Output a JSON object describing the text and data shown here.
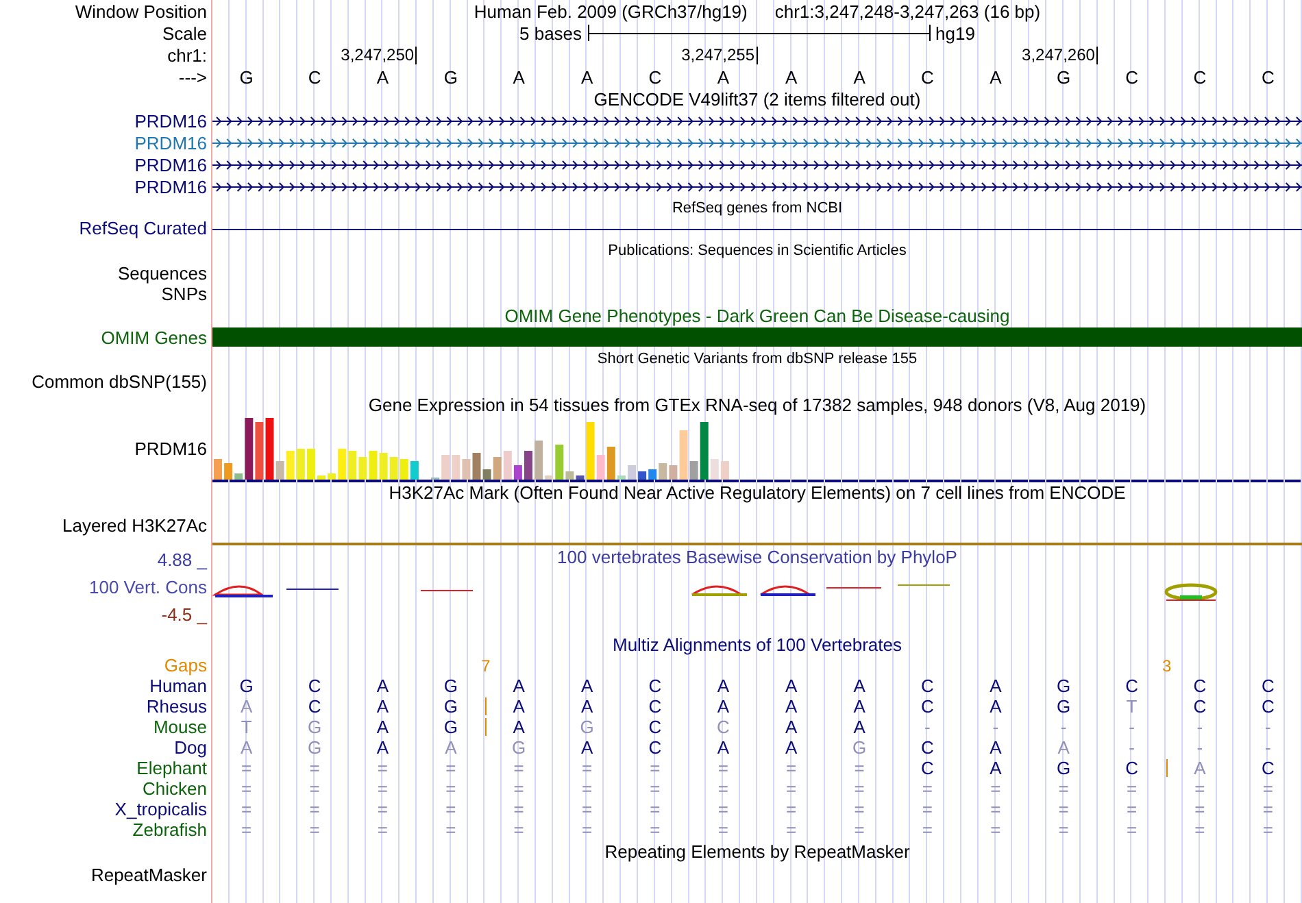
{
  "header": {
    "label": "Window Position",
    "assembly": "Human Feb. 2009 (GRCh37/hg19)",
    "position": "chr1:3,247,248-3,247,263 (16 bp)"
  },
  "scale": {
    "label": "Scale",
    "bar_label": "5 bases",
    "db": "hg19"
  },
  "ruler": {
    "label": "chr1:",
    "ticks": [
      "3,247,250",
      "3,247,255",
      "3,247,260"
    ]
  },
  "bases": {
    "label": "--->",
    "letters": [
      "G",
      "C",
      "A",
      "G",
      "A",
      "A",
      "C",
      "A",
      "A",
      "A",
      "C",
      "A",
      "G",
      "C",
      "C",
      "C"
    ]
  },
  "gencode": {
    "title": "GENCODE V49lift37 (2 items filtered out)",
    "genes": [
      {
        "name": "PRDM16",
        "color": "#0c0c78"
      },
      {
        "name": "PRDM16",
        "color": "#1f78b4"
      },
      {
        "name": "PRDM16",
        "color": "#0c0c78"
      },
      {
        "name": "PRDM16",
        "color": "#0c0c78"
      }
    ]
  },
  "refseq": {
    "title": "RefSeq genes from NCBI",
    "label": "RefSeq Curated"
  },
  "publications": {
    "title": "Publications: Sequences in Scientific Articles",
    "labels": [
      "Sequences",
      "SNPs"
    ]
  },
  "omim": {
    "title": "OMIM Gene Phenotypes - Dark Green Can Be Disease-causing",
    "label": "OMIM Genes"
  },
  "dbsnp": {
    "title": "Short Genetic Variants from dbSNP release 155",
    "label": "Common dbSNP(155)"
  },
  "gtex": {
    "title": "Gene Expression in 54 tissues from GTEx RNA-seq of 17382 samples, 948 donors (V8, Aug 2019)",
    "label": "PRDM16"
  },
  "h3k27ac": {
    "title": "H3K27Ac Mark (Often Found Near Active Regulatory Elements) on 7 cell lines from ENCODE",
    "label": "Layered H3K27Ac"
  },
  "phylop": {
    "title": "100 vertebrates Basewise Conservation by PhyloP",
    "max": "4.88 _",
    "label": "100 Vert. Cons",
    "min": "-4.5 _"
  },
  "multiz": {
    "title": "Multiz Alignments of 100 Vertebrates",
    "gaps_label": "Gaps",
    "species": [
      {
        "name": "Human",
        "color": "#0c0c78",
        "bases": [
          {
            "base": "G",
            "faded": false,
            "insert": false
          },
          {
            "base": "C",
            "faded": false,
            "insert": false
          },
          {
            "base": "A",
            "faded": false,
            "insert": false
          },
          {
            "base": "G",
            "faded": false,
            "insert": false,
            "gap_count": "7"
          },
          {
            "base": "A",
            "faded": false,
            "insert": false
          },
          {
            "base": "A",
            "faded": false,
            "insert": false
          },
          {
            "base": "C",
            "faded": false,
            "insert": false
          },
          {
            "base": "A",
            "faded": false,
            "insert": false
          },
          {
            "base": "A",
            "faded": false,
            "insert": false
          },
          {
            "base": "A",
            "faded": false,
            "insert": false
          },
          {
            "base": "C",
            "faded": false,
            "insert": false
          },
          {
            "base": "A",
            "faded": false,
            "insert": false
          },
          {
            "base": "G",
            "faded": false,
            "insert": false
          },
          {
            "base": "C",
            "faded": false,
            "insert": false,
            "gap_count": "3"
          },
          {
            "base": "C",
            "faded": false,
            "insert": false
          },
          {
            "base": "C",
            "faded": false,
            "insert": false
          }
        ]
      },
      {
        "name": "Rhesus",
        "color": "#0c0c78",
        "bases": [
          {
            "base": "A",
            "faded": true,
            "insert": false
          },
          {
            "base": "C",
            "faded": false,
            "insert": false
          },
          {
            "base": "A",
            "faded": false,
            "insert": false
          },
          {
            "base": "G",
            "faded": false,
            "insert": true
          },
          {
            "base": "A",
            "faded": false,
            "insert": false
          },
          {
            "base": "A",
            "faded": false,
            "insert": false
          },
          {
            "base": "C",
            "faded": false,
            "insert": false
          },
          {
            "base": "A",
            "faded": false,
            "insert": false
          },
          {
            "base": "A",
            "faded": false,
            "insert": false
          },
          {
            "base": "A",
            "faded": false,
            "insert": false
          },
          {
            "base": "C",
            "faded": false,
            "insert": false
          },
          {
            "base": "A",
            "faded": false,
            "insert": false
          },
          {
            "base": "G",
            "faded": false,
            "insert": false
          },
          {
            "base": "T",
            "faded": true,
            "insert": false
          },
          {
            "base": "C",
            "faded": false,
            "insert": false
          },
          {
            "base": "C",
            "faded": false,
            "insert": false
          }
        ]
      },
      {
        "name": "Mouse",
        "color": "#0d640d",
        "bases": [
          {
            "base": "T",
            "faded": true,
            "insert": false
          },
          {
            "base": "G",
            "faded": true,
            "insert": false
          },
          {
            "base": "A",
            "faded": false,
            "insert": false
          },
          {
            "base": "G",
            "faded": false,
            "insert": true
          },
          {
            "base": "A",
            "faded": false,
            "insert": false
          },
          {
            "base": "G",
            "faded": true,
            "insert": false
          },
          {
            "base": "C",
            "faded": false,
            "insert": false
          },
          {
            "base": "C",
            "faded": true,
            "insert": false
          },
          {
            "base": "A",
            "faded": false,
            "insert": false
          },
          {
            "base": "A",
            "faded": false,
            "insert": false
          },
          {
            "base": "-",
            "faded": true,
            "insert": false
          },
          {
            "base": "-",
            "faded": true,
            "insert": false
          },
          {
            "base": "-",
            "faded": true,
            "insert": false
          },
          {
            "base": "-",
            "faded": true,
            "insert": false
          },
          {
            "base": "-",
            "faded": true,
            "insert": false
          },
          {
            "base": "-",
            "faded": true,
            "insert": false
          }
        ]
      },
      {
        "name": "Dog",
        "color": "#0c0c78",
        "bases": [
          {
            "base": "A",
            "faded": true,
            "insert": false
          },
          {
            "base": "G",
            "faded": true,
            "insert": false
          },
          {
            "base": "A",
            "faded": false,
            "insert": false
          },
          {
            "base": "A",
            "faded": true,
            "insert": false
          },
          {
            "base": "G",
            "faded": true,
            "insert": false
          },
          {
            "base": "A",
            "faded": false,
            "insert": false
          },
          {
            "base": "C",
            "faded": false,
            "insert": false
          },
          {
            "base": "A",
            "faded": false,
            "insert": false
          },
          {
            "base": "A",
            "faded": false,
            "insert": false
          },
          {
            "base": "G",
            "faded": true,
            "insert": false
          },
          {
            "base": "C",
            "faded": false,
            "insert": false
          },
          {
            "base": "A",
            "faded": false,
            "insert": false
          },
          {
            "base": "A",
            "faded": true,
            "insert": false
          },
          {
            "base": "-",
            "faded": true,
            "insert": false
          },
          {
            "base": "-",
            "faded": true,
            "insert": false
          },
          {
            "base": "-",
            "faded": true,
            "insert": false
          }
        ]
      },
      {
        "name": "Elephant",
        "color": "#0d640d",
        "bases": [
          {
            "base": "=",
            "faded": true,
            "insert": false
          },
          {
            "base": "=",
            "faded": true,
            "insert": false
          },
          {
            "base": "=",
            "faded": true,
            "insert": false
          },
          {
            "base": "=",
            "faded": true,
            "insert": false
          },
          {
            "base": "=",
            "faded": true,
            "insert": false
          },
          {
            "base": "=",
            "faded": true,
            "insert": false
          },
          {
            "base": "=",
            "faded": true,
            "insert": false
          },
          {
            "base": "=",
            "faded": true,
            "insert": false
          },
          {
            "base": "=",
            "faded": true,
            "insert": false
          },
          {
            "base": "=",
            "faded": true,
            "insert": false
          },
          {
            "base": "C",
            "faded": false,
            "insert": false
          },
          {
            "base": "A",
            "faded": false,
            "insert": false
          },
          {
            "base": "G",
            "faded": false,
            "insert": false
          },
          {
            "base": "C",
            "faded": false,
            "insert": true
          },
          {
            "base": "A",
            "faded": true,
            "insert": false
          },
          {
            "base": "C",
            "faded": false,
            "insert": false
          }
        ]
      },
      {
        "name": "Chicken",
        "color": "#0d640d",
        "bases": [
          {
            "base": "=",
            "faded": true,
            "insert": false
          },
          {
            "base": "=",
            "faded": true,
            "insert": false
          },
          {
            "base": "=",
            "faded": true,
            "insert": false
          },
          {
            "base": "=",
            "faded": true,
            "insert": false
          },
          {
            "base": "=",
            "faded": true,
            "insert": false
          },
          {
            "base": "=",
            "faded": true,
            "insert": false
          },
          {
            "base": "=",
            "faded": true,
            "insert": false
          },
          {
            "base": "=",
            "faded": true,
            "insert": false
          },
          {
            "base": "=",
            "faded": true,
            "insert": false
          },
          {
            "base": "=",
            "faded": true,
            "insert": false
          },
          {
            "base": "=",
            "faded": true,
            "insert": false
          },
          {
            "base": "=",
            "faded": true,
            "insert": false
          },
          {
            "base": "=",
            "faded": true,
            "insert": false
          },
          {
            "base": "=",
            "faded": true,
            "insert": false
          },
          {
            "base": "=",
            "faded": true,
            "insert": false
          },
          {
            "base": "=",
            "faded": true,
            "insert": false
          }
        ]
      },
      {
        "name": "X_tropicalis",
        "color": "#0c0c78",
        "bases": [
          {
            "base": "=",
            "faded": true,
            "insert": false
          },
          {
            "base": "=",
            "faded": true,
            "insert": false
          },
          {
            "base": "=",
            "faded": true,
            "insert": false
          },
          {
            "base": "=",
            "faded": true,
            "insert": false
          },
          {
            "base": "=",
            "faded": true,
            "insert": false
          },
          {
            "base": "=",
            "faded": true,
            "insert": false
          },
          {
            "base": "=",
            "faded": true,
            "insert": false
          },
          {
            "base": "=",
            "faded": true,
            "insert": false
          },
          {
            "base": "=",
            "faded": true,
            "insert": false
          },
          {
            "base": "=",
            "faded": true,
            "insert": false
          },
          {
            "base": "=",
            "faded": true,
            "insert": false
          },
          {
            "base": "=",
            "faded": true,
            "insert": false
          },
          {
            "base": "=",
            "faded": true,
            "insert": false
          },
          {
            "base": "=",
            "faded": true,
            "insert": false
          },
          {
            "base": "=",
            "faded": true,
            "insert": false
          },
          {
            "base": "=",
            "faded": true,
            "insert": false
          }
        ]
      },
      {
        "name": "Zebrafish",
        "color": "#0d640d",
        "bases": [
          {
            "base": "=",
            "faded": true,
            "insert": false
          },
          {
            "base": "=",
            "faded": true,
            "insert": false
          },
          {
            "base": "=",
            "faded": true,
            "insert": false
          },
          {
            "base": "=",
            "faded": true,
            "insert": false
          },
          {
            "base": "=",
            "faded": true,
            "insert": false
          },
          {
            "base": "=",
            "faded": true,
            "insert": false
          },
          {
            "base": "=",
            "faded": true,
            "insert": false
          },
          {
            "base": "=",
            "faded": true,
            "insert": false
          },
          {
            "base": "=",
            "faded": true,
            "insert": false
          },
          {
            "base": "=",
            "faded": true,
            "insert": false
          },
          {
            "base": "=",
            "faded": true,
            "insert": false
          },
          {
            "base": "=",
            "faded": true,
            "insert": false
          },
          {
            "base": "=",
            "faded": true,
            "insert": false
          },
          {
            "base": "=",
            "faded": true,
            "insert": false
          },
          {
            "base": "=",
            "faded": true,
            "insert": false
          },
          {
            "base": "=",
            "faded": true,
            "insert": false
          }
        ]
      }
    ]
  },
  "repeatmasker": {
    "title": "Repeating Elements by RepeatMasker",
    "label": "RepeatMasker"
  }
}
